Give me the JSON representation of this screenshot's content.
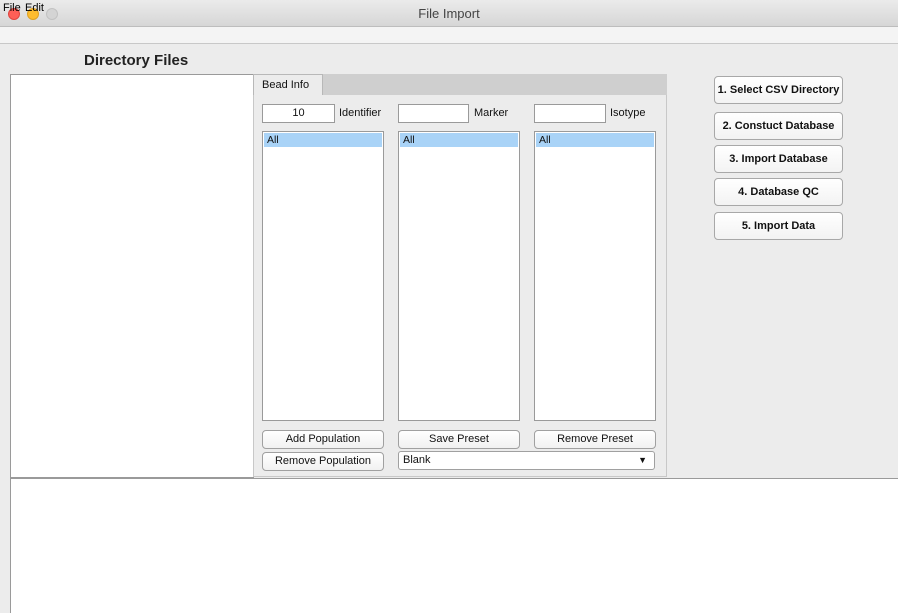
{
  "window": {
    "title": "File Import"
  },
  "menu": [
    "File",
    "Edit"
  ],
  "directory_files": {
    "title": "Directory Files"
  },
  "tabs": [
    {
      "label": "Bead Info"
    }
  ],
  "bead_info": {
    "identifier": {
      "value": "10",
      "label": "Identifier"
    },
    "marker": {
      "value": "",
      "label": "Marker"
    },
    "isotype": {
      "value": "",
      "label": "Isotype"
    },
    "lists": {
      "identifier": [
        "All"
      ],
      "marker": [
        "All"
      ],
      "isotype": [
        "All"
      ]
    },
    "buttons": {
      "add_population": "Add Population",
      "save_preset": "Save Preset",
      "remove_preset": "Remove Preset",
      "remove_population": "Remove Population"
    },
    "preset_select": {
      "selected": "Blank"
    }
  },
  "steps": [
    "1. Select CSV Directory",
    "2. Constuct Database",
    "3. Import Database",
    "4. Database QC",
    "5. Import Data"
  ],
  "colors": {
    "close": "#fe5f57",
    "minimize": "#febc2e",
    "maximize_disabled": "#d4d4d4",
    "selection": "#a9d3f7"
  }
}
